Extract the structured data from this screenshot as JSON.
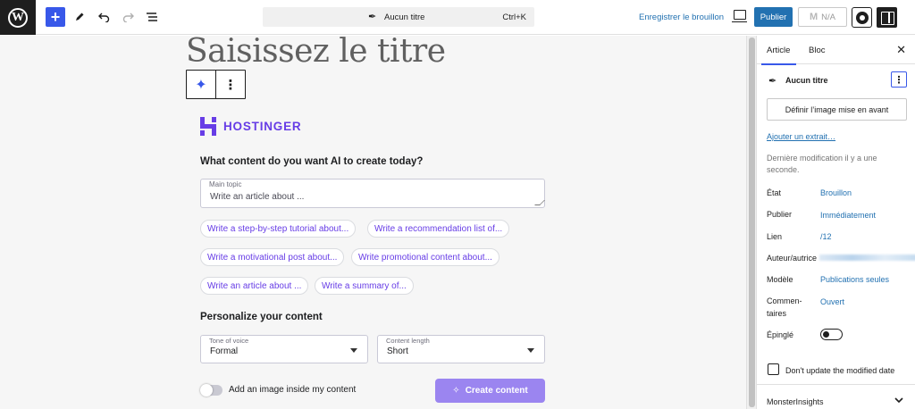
{
  "topbar": {
    "command_title": "Aucun titre",
    "command_shortcut": "Ctrl+K",
    "save_draft": "Enregistrer le brouillon",
    "publish": "Publier",
    "na_label": "N/A"
  },
  "editor": {
    "title_placeholder": "Saisissez le titre",
    "brand": "HOSTINGER",
    "heading_ai": "What content do you want AI to create today?",
    "main_topic_label": "Main topic",
    "main_topic_placeholder": "Write an article about ...",
    "suggestions": [
      "Write a step-by-step tutorial about...",
      "Write a recommendation list of...",
      "Write a motivational post about...",
      "Write promotional content about...",
      "Write an article about ...",
      "Write a summary of..."
    ],
    "heading_personalize": "Personalize your content",
    "tone_label": "Tone of voice",
    "tone_value": "Formal",
    "length_label": "Content length",
    "length_value": "Short",
    "image_toggle_label": "Add an image inside my content",
    "create_button": "Create content"
  },
  "sidebar": {
    "tab_article": "Article",
    "tab_bloc": "Bloc",
    "post_title": "Aucun titre",
    "featured_image": "Définir l’image mise en avant",
    "add_excerpt": "Ajouter un extrait…",
    "last_modified": "Dernière modification il y a une seconde.",
    "rows": {
      "etat_label": "État",
      "etat_value": "Brouillon",
      "publier_label": "Publier",
      "publier_value": "Immédiatement",
      "lien_label": "Lien",
      "lien_value": "/12",
      "auteur_label": "Auteur/autrice",
      "modele_label": "Modèle",
      "modele_value": "Publications seules",
      "comment_label_1": "Commen-",
      "comment_label_2": "taires",
      "comment_value": "Ouvert",
      "epingle_label": "Épinglé"
    },
    "dont_update": "Don't update the modified date",
    "monsterinsights": "MonsterInsights"
  },
  "colors": {
    "wp_blue": "#3858e9",
    "link_blue": "#2271b1",
    "hostinger_purple": "#673de6",
    "create_button": "#9b85f0"
  }
}
